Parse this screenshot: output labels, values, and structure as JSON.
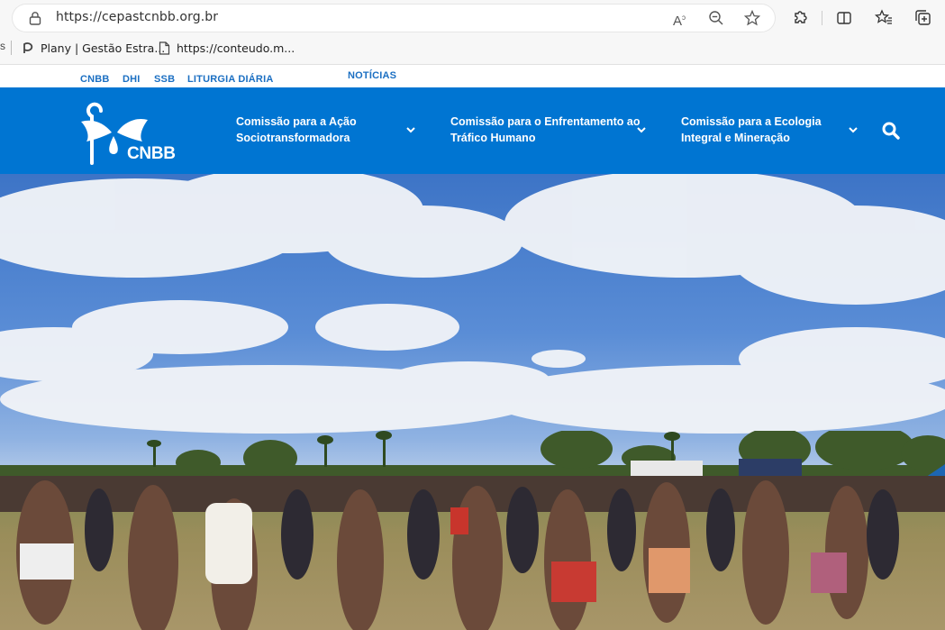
{
  "browser": {
    "url": "https://cepastcnbb.org.br",
    "bookmarks": [
      {
        "label": "Plany | Gestão Estra...",
        "icon": "plany-icon"
      },
      {
        "label": "https://conteudo.m...",
        "icon": "page-icon"
      }
    ]
  },
  "topnav": {
    "items": [
      "CNBB",
      "DHI",
      "SSB",
      "LITURGIA DIÁRIA",
      "NOTÍCIAS"
    ]
  },
  "header": {
    "logo_text": "CNBB",
    "menu": [
      {
        "line1": "Comissão para a Ação",
        "line2": "Sociotransformadora"
      },
      {
        "line1": "Comissão para o Enfrentamento ao",
        "line2": "Tráfico Humano"
      },
      {
        "line1": "Comissão para a Ecologia",
        "line2": "Integral e Mineração"
      }
    ],
    "colors": {
      "header_bg": "#0075d2",
      "topnav_link": "#1b6fc2"
    }
  },
  "hero": {
    "icon": "hero-photo-indigenous-circle-dance"
  }
}
